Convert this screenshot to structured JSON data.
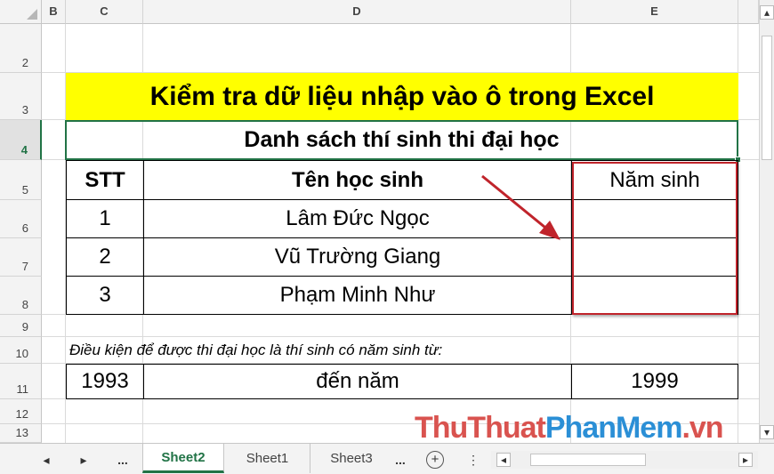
{
  "columns": [
    "B",
    "C",
    "D",
    "E"
  ],
  "rows": [
    "2",
    "3",
    "4",
    "5",
    "6",
    "7",
    "8",
    "9",
    "10",
    "11",
    "12",
    "13"
  ],
  "title": "Kiểm tra dữ liệu nhập vào ô trong Excel",
  "subtitle": "Danh sách thí sinh thi đại học",
  "table": {
    "headers": [
      "STT",
      "Tên học sinh",
      "Năm sinh"
    ],
    "rows": [
      {
        "stt": "1",
        "name": "Lâm Đức Ngọc",
        "year": ""
      },
      {
        "stt": "2",
        "name": "Vũ Trường Giang",
        "year": ""
      },
      {
        "stt": "3",
        "name": "Phạm Minh Như",
        "year": ""
      }
    ]
  },
  "condition": {
    "text": "Điều kiện để được thi đại học là thí sinh có năm sinh từ:",
    "from_year": "1993",
    "mid_text": "đến năm",
    "to_year": "1999"
  },
  "tabs": {
    "nav_prev": "◂",
    "nav_next": "▸",
    "ellipsis_left": "...",
    "items": [
      "Sheet2",
      "Sheet1",
      "Sheet3"
    ],
    "ellipsis_right": "...",
    "add": "+",
    "more": "⋮"
  },
  "scroll": {
    "left_arrow": "◂",
    "right_arrow": "▸",
    "up_arrow": "▴",
    "down_arrow": "▾"
  },
  "watermark": {
    "part1": "ThuThuat",
    "part2": "PhanMem",
    "part3": ".vn"
  },
  "colors": {
    "title_fill": "#ffff00",
    "excel_green": "#217346",
    "highlight_red": "#c0242b"
  }
}
